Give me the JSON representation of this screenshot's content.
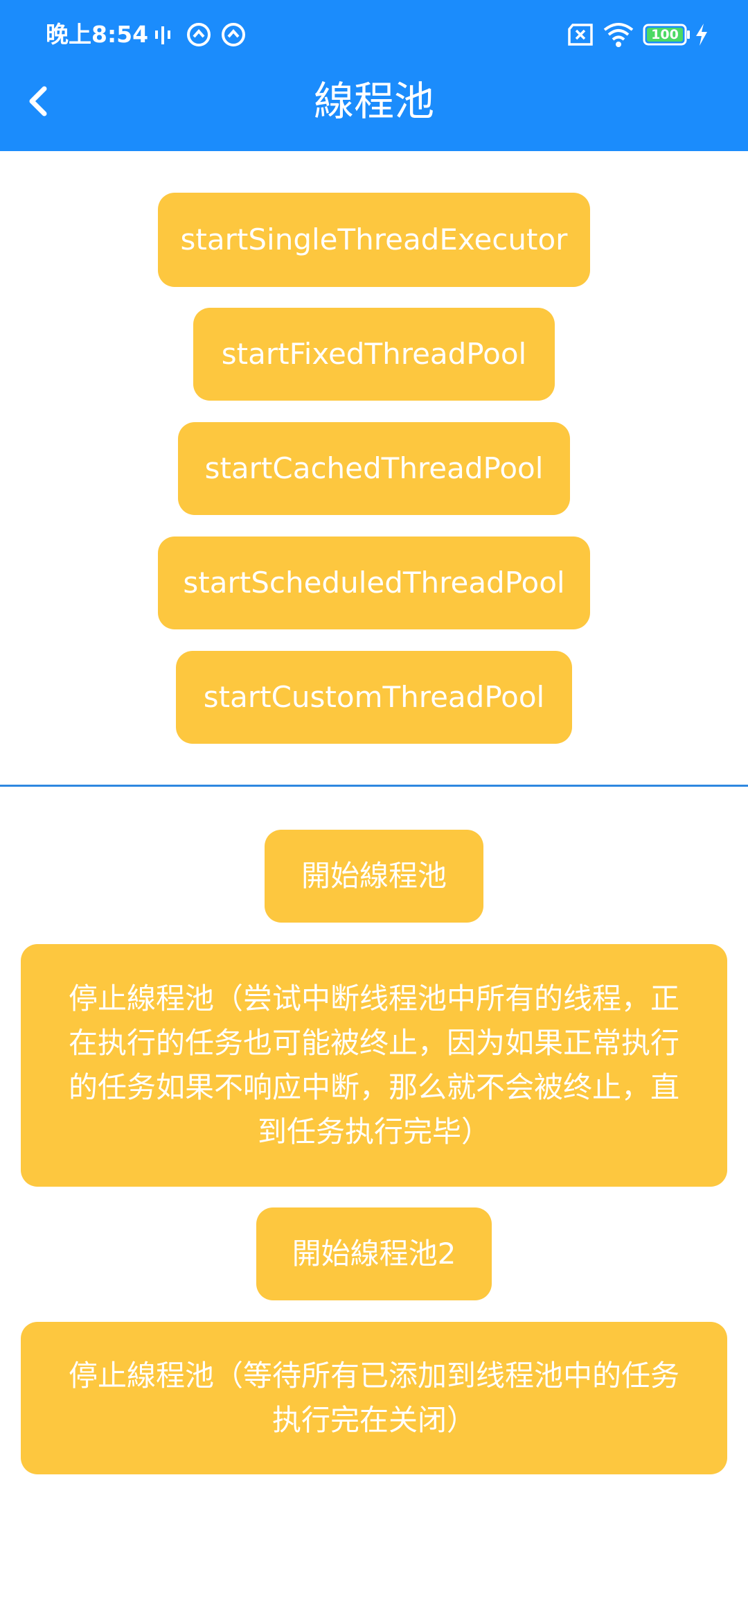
{
  "status_bar": {
    "time": "晚上8:54",
    "battery": "100",
    "icons": [
      "vibrate-icon",
      "sync-icon",
      "sync-icon",
      "sim-none-icon",
      "wifi-icon",
      "battery-icon",
      "charging-icon"
    ]
  },
  "header": {
    "title": "線程池",
    "back_icon": "chevron-left-icon"
  },
  "colors": {
    "header_bg": "#1b8cfc",
    "button_bg": "#fdc73f",
    "button_text": "#ffffff",
    "divider": "#2e88e0"
  },
  "executor_buttons": [
    "startSingleThreadExecutor",
    "startFixedThreadPool",
    "startCachedThreadPool",
    "startScheduledThreadPool",
    "startCustomThreadPool"
  ],
  "pool_buttons": {
    "start": "開始線程池",
    "stop_now": "停止線程池（尝试中断线程池中所有的线程，正在执行的任务也可能被终止，因为如果正常执行的任务如果不响应中断，那么就不会被终止，直到任务执行完毕）",
    "start2": "開始線程池2",
    "stop_graceful": "停止線程池（等待所有已添加到线程池中的任务执行完在关闭）"
  }
}
